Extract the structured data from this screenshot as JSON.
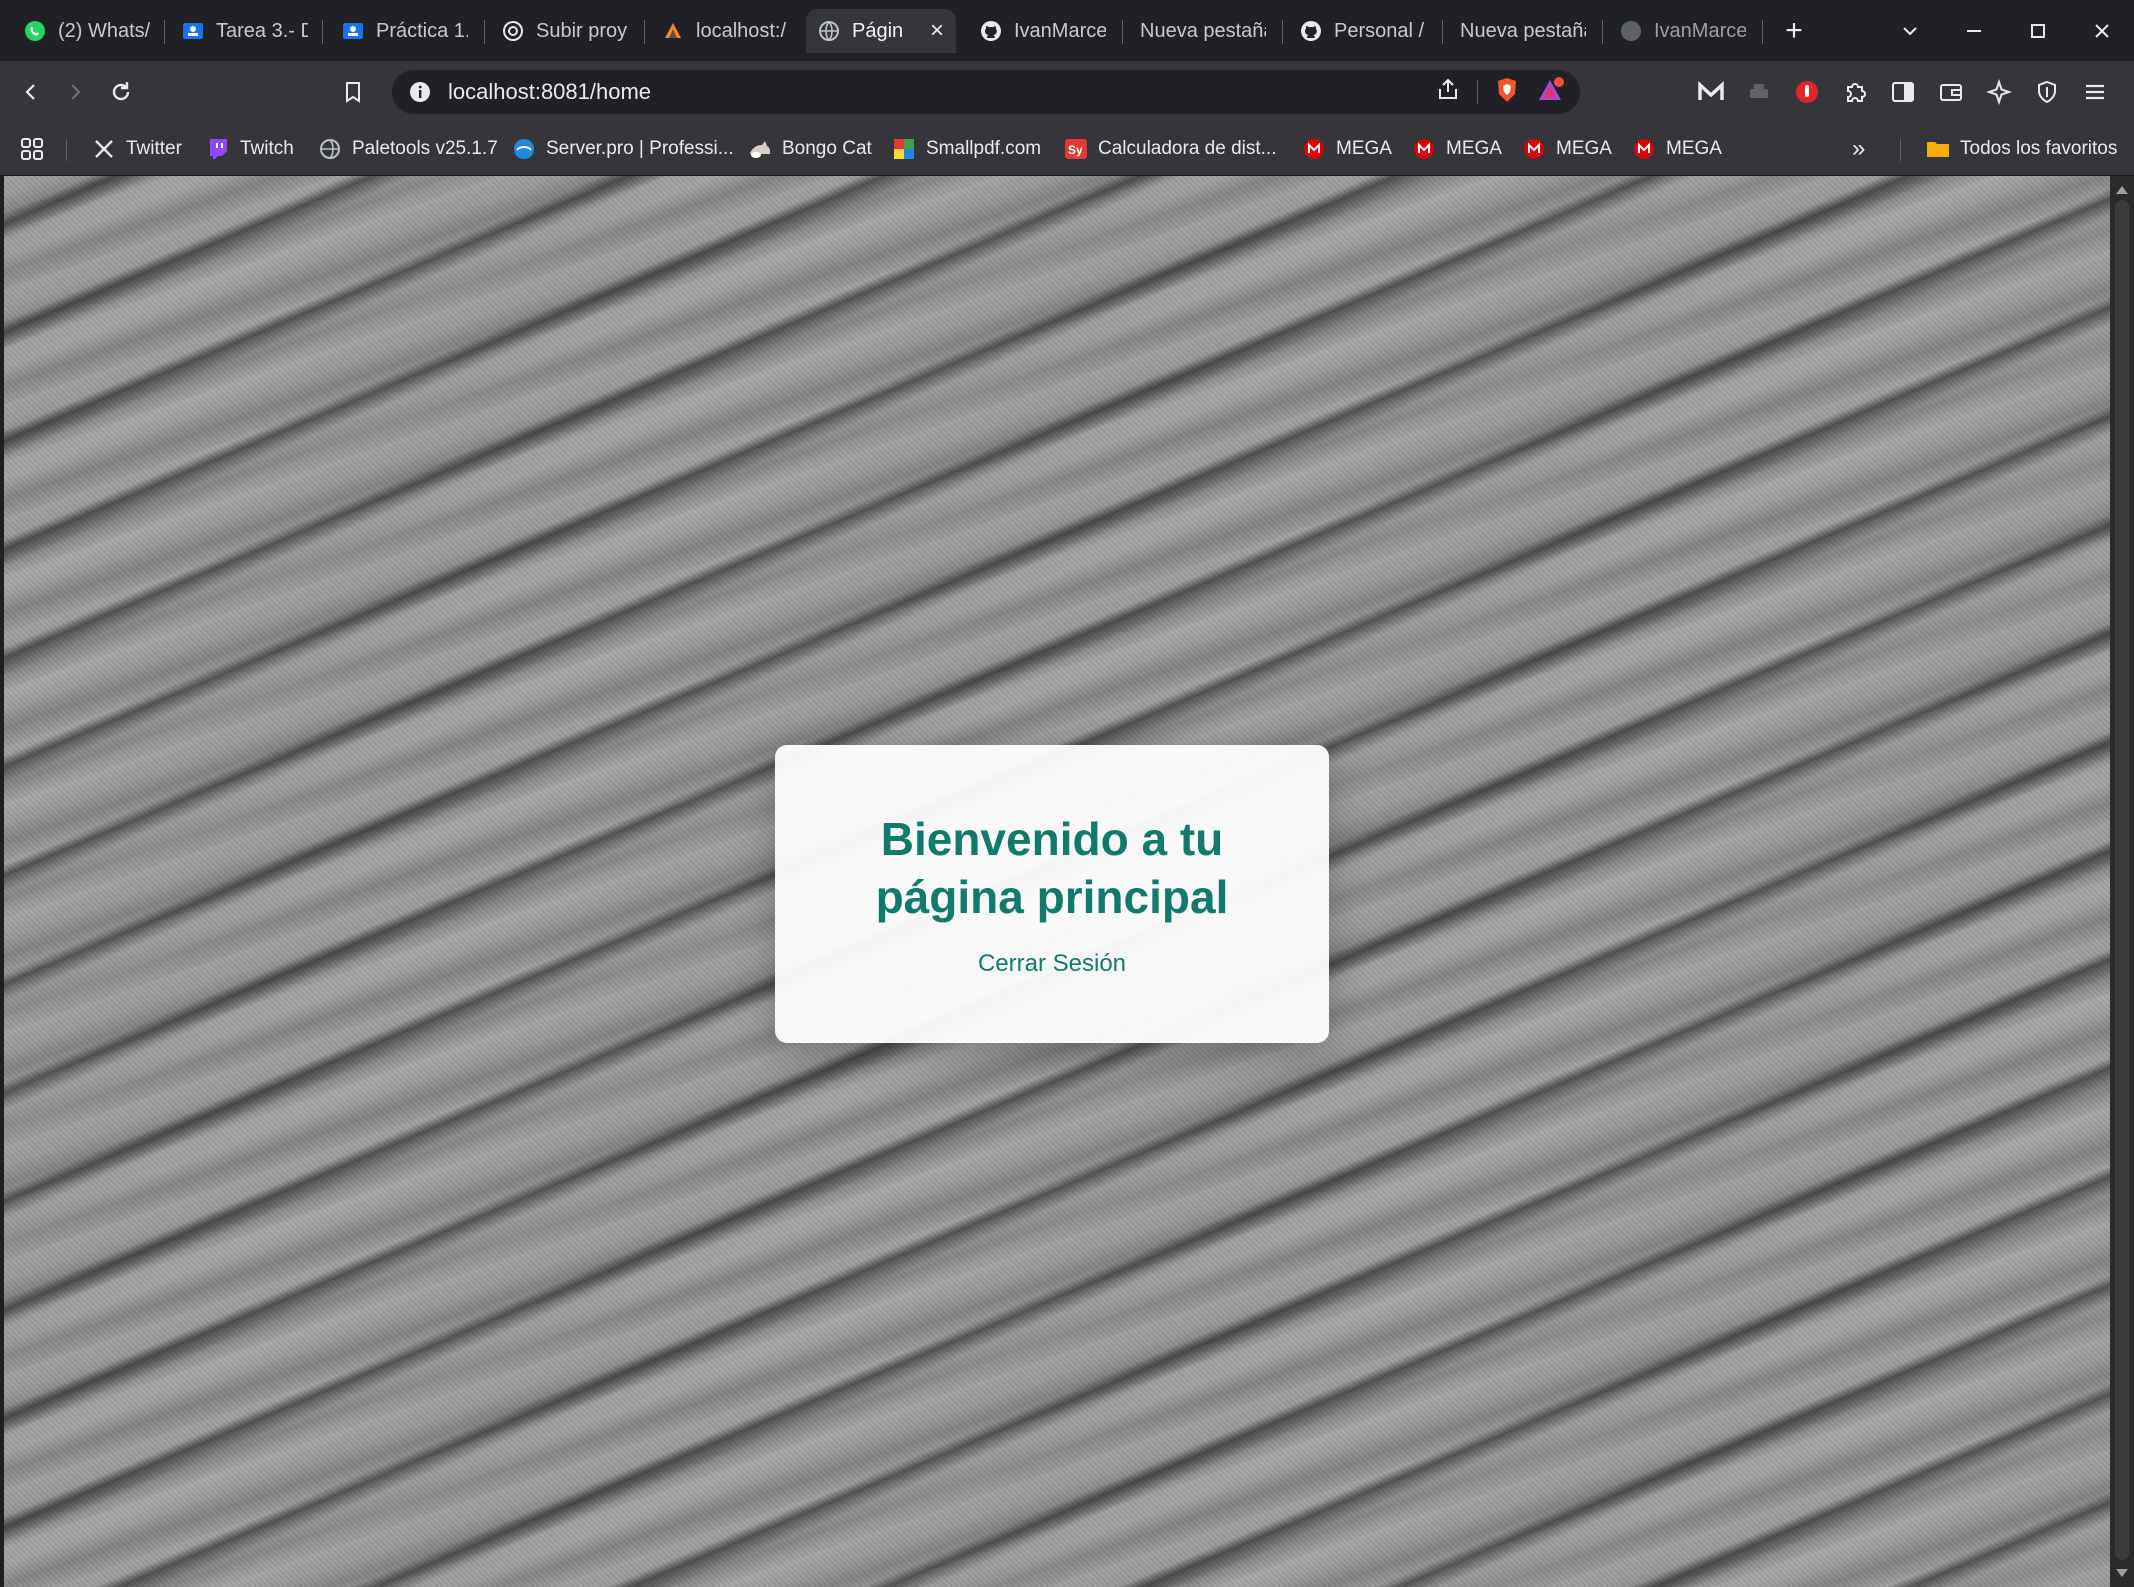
{
  "browser": {
    "tabs": [
      {
        "id": "whatsapp",
        "title": "(2) Whats/",
        "icon": "whatsapp-icon"
      },
      {
        "id": "tarea",
        "title": "Tarea 3.- D",
        "icon": "classroom-icon"
      },
      {
        "id": "practica",
        "title": "Práctica 1.",
        "icon": "classroom-icon"
      },
      {
        "id": "subir",
        "title": "Subir proy",
        "icon": "openai-icon"
      },
      {
        "id": "localhost1",
        "title": "localhost:/",
        "icon": "ship-icon"
      },
      {
        "id": "pagina",
        "title": "Págin",
        "icon": "globe-icon",
        "active": true
      },
      {
        "id": "ivan1",
        "title": "IvanMarce",
        "icon": "github-icon"
      },
      {
        "id": "nueva1",
        "title": "Nueva pestaña",
        "icon": ""
      },
      {
        "id": "personal",
        "title": "Personal /",
        "icon": "github-icon"
      },
      {
        "id": "nueva2",
        "title": "Nueva pestaña",
        "icon": ""
      },
      {
        "id": "ivan2",
        "title": "IvanMarce",
        "icon": "github-icon"
      }
    ],
    "new_tab_label": "+",
    "address": {
      "url": "localhost:8081/home"
    },
    "bookmarks": [
      {
        "id": "apps",
        "label": "",
        "icon": "apps-grid-icon"
      },
      {
        "id": "twitter",
        "label": "Twitter",
        "icon": "x-icon"
      },
      {
        "id": "twitch",
        "label": "Twitch",
        "icon": "twitch-icon"
      },
      {
        "id": "paletools",
        "label": "Paletools v25.1.7",
        "icon": "globe-icon"
      },
      {
        "id": "serverpro",
        "label": "Server.pro | Professi...",
        "icon": "server-icon"
      },
      {
        "id": "bongo",
        "label": "Bongo Cat",
        "icon": "cat-icon"
      },
      {
        "id": "smallpdf",
        "label": "Smallpdf.com",
        "icon": "smallpdf-icon"
      },
      {
        "id": "calc",
        "label": "Calculadora de dist...",
        "icon": "sy-icon"
      },
      {
        "id": "mega1",
        "label": "MEGA",
        "icon": "mega-icon"
      },
      {
        "id": "mega2",
        "label": "MEGA",
        "icon": "mega-icon"
      },
      {
        "id": "mega3",
        "label": "MEGA",
        "icon": "mega-icon"
      },
      {
        "id": "mega4",
        "label": "MEGA",
        "icon": "mega-icon"
      }
    ],
    "overflow_label": "»",
    "all_bookmarks_label": "Todos los favoritos",
    "colors": {
      "tab_bg": "#202124",
      "toolbar_bg": "#35363a",
      "accent_green": "#117a6b",
      "mega_red": "#d90007",
      "brave_orange": "#fb542b"
    }
  },
  "page": {
    "heading_line1": "Bienvenido a tu",
    "heading_line2": "página principal",
    "logout_label": "Cerrar Sesión"
  }
}
